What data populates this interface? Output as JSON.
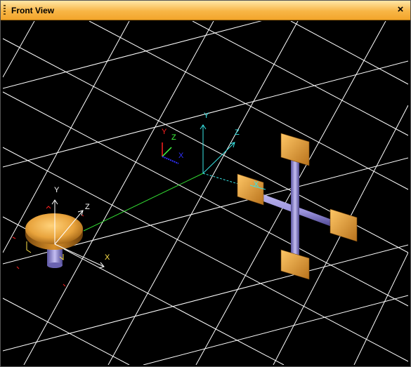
{
  "window": {
    "title": "Front View",
    "close_glyph": "×"
  },
  "viewport": {
    "background": "#000000",
    "grid_color": "#ffffff",
    "axis_labels": {
      "world": {
        "x": "X",
        "y": "Y",
        "z": "Z"
      },
      "small": {
        "x": "X",
        "y": "Y",
        "z": "Z"
      },
      "disk": {
        "x": "X",
        "y": "Y",
        "z": "Z"
      },
      "cross": {
        "x": "X"
      }
    },
    "colors": {
      "world_axes": "#39e6e6",
      "link_line": "#33dd33",
      "object_gold": "#e8a33c",
      "rod_lavender": "#9a92dc",
      "axis_red": "#ff2020",
      "axis_green": "#40ff40",
      "axis_blue": "#3030ff"
    }
  }
}
